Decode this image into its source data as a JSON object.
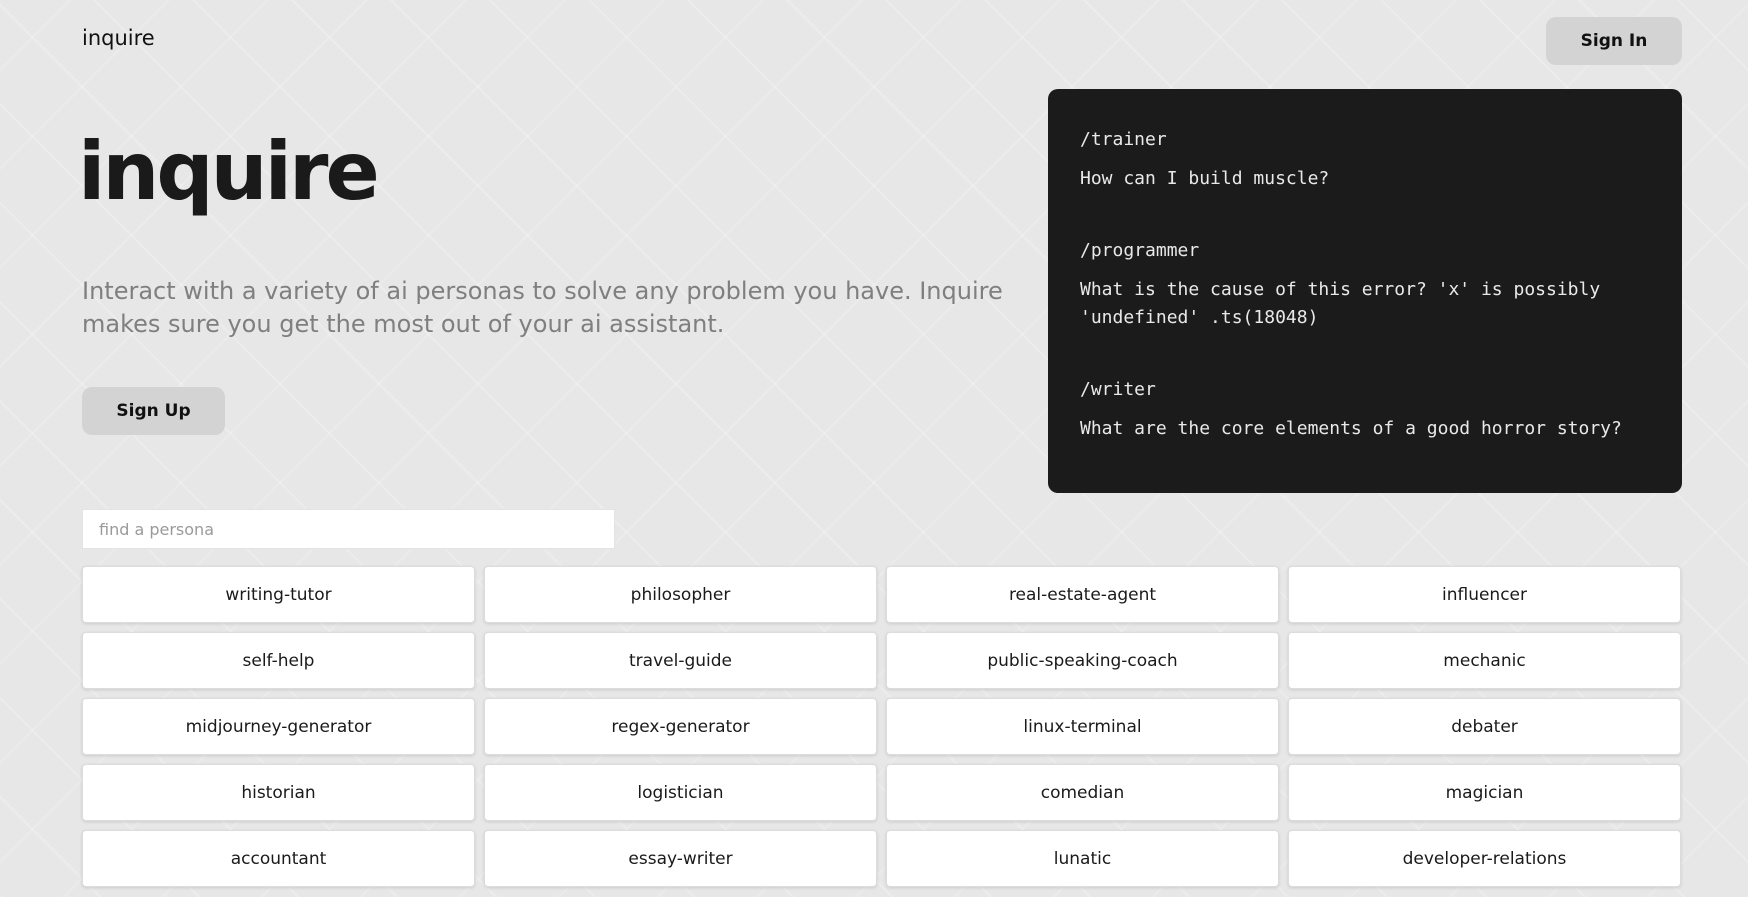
{
  "header": {
    "brand": "inquire",
    "sign_in_label": "Sign In"
  },
  "hero": {
    "title": "inquire",
    "subtitle": "Interact with a variety of ai personas to solve any problem you have. Inquire makes sure you get the most out of your ai assistant.",
    "sign_up_label": "Sign Up"
  },
  "examples": [
    {
      "command": "/trainer",
      "prompt": "How can I build muscle?"
    },
    {
      "command": "/programmer",
      "prompt": "What is the cause of this error? 'x' is possibly\n'undefined' .ts(18048)"
    },
    {
      "command": "/writer",
      "prompt": "What are the core elements of a good horror story?"
    }
  ],
  "search": {
    "placeholder": "find a persona",
    "value": ""
  },
  "personas": [
    "writing-tutor",
    "philosopher",
    "real-estate-agent",
    "influencer",
    "self-help",
    "travel-guide",
    "public-speaking-coach",
    "mechanic",
    "midjourney-generator",
    "regex-generator",
    "linux-terminal",
    "debater",
    "historian",
    "logistician",
    "comedian",
    "magician",
    "accountant",
    "essay-writer",
    "lunatic",
    "developer-relations"
  ]
}
